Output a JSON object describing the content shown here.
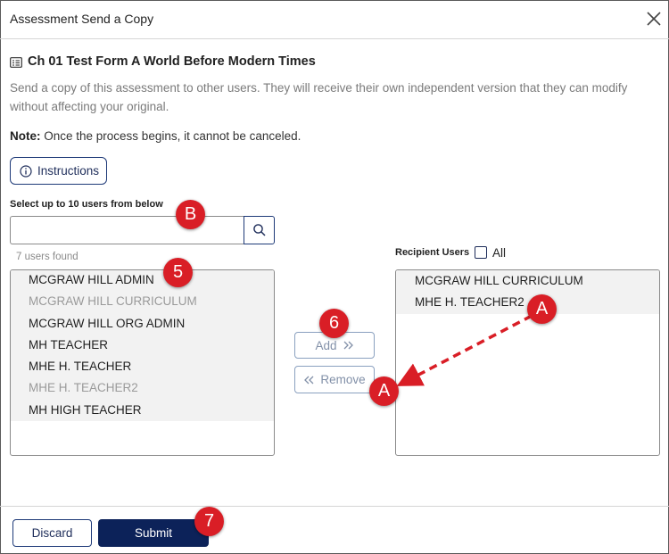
{
  "dialog": {
    "title": "Assessment Send a Copy"
  },
  "assessment": {
    "title": "Ch 01 Test Form A World Before Modern Times",
    "description": "Send a copy of this assessment to other users. They will receive their own independent version that they can modify without affecting your original.",
    "note_label": "Note:",
    "note_text": " Once the process begins, it cannot be canceled."
  },
  "instructions_button": "Instructions",
  "search": {
    "label": "Select up to 10 users from below",
    "value": "",
    "placeholder": "",
    "results_count": "7 users found"
  },
  "available_users": [
    {
      "name": "MCGRAW HILL ADMIN",
      "disabled": false
    },
    {
      "name": "MCGRAW HILL CURRICULUM",
      "disabled": true
    },
    {
      "name": "MCGRAW HILL ORG ADMIN",
      "disabled": false
    },
    {
      "name": "MH TEACHER",
      "disabled": false
    },
    {
      "name": "MHE H. TEACHER",
      "disabled": false
    },
    {
      "name": "MHE H. TEACHER2",
      "disabled": true
    },
    {
      "name": "MH HIGH TEACHER",
      "disabled": false
    }
  ],
  "transfer": {
    "add_label": "Add",
    "remove_label": "Remove"
  },
  "recipients": {
    "label": "Recipient Users",
    "all_label": "All",
    "all_checked": false,
    "users": [
      {
        "name": "MCGRAW HILL CURRICULUM"
      },
      {
        "name": "MHE H. TEACHER2"
      }
    ]
  },
  "footer": {
    "discard_label": "Discard",
    "submit_label": "Submit"
  },
  "callouts": {
    "b": "B",
    "five": "5",
    "six": "6",
    "seven": "7",
    "a_start": "A",
    "a_end": "A"
  },
  "colors": {
    "primary_navy": "#0c2259",
    "callout_red": "#d91e26",
    "muted_text": "#7a7a7a"
  }
}
